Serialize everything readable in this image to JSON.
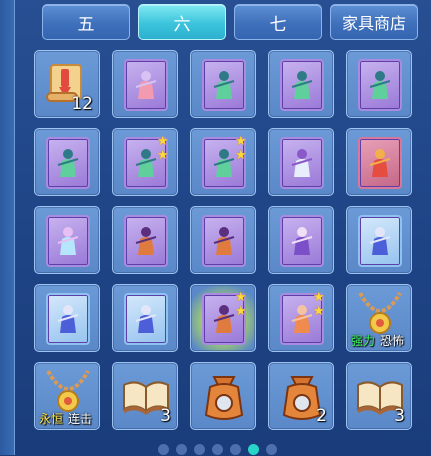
{
  "tabs": [
    {
      "label": "五",
      "active": false
    },
    {
      "label": "六",
      "active": true
    },
    {
      "label": "七",
      "active": false
    },
    {
      "label": "家具商店",
      "active": false
    }
  ],
  "items": [
    {
      "name": "scroll-item",
      "icon": "scroll-icon",
      "count": "12"
    },
    {
      "name": "pet-card",
      "icon": "pink-pet-card-icon",
      "count": ""
    },
    {
      "name": "hero-card",
      "icon": "green-warrior-card-icon",
      "count": ""
    },
    {
      "name": "hero-card",
      "icon": "green-warrior-card-icon",
      "count": ""
    },
    {
      "name": "hero-card",
      "icon": "green-warrior-card-icon",
      "count": ""
    },
    {
      "name": "hero-card",
      "icon": "green-warrior-card-icon",
      "count": ""
    },
    {
      "name": "hero-card",
      "icon": "green-warrior-card-icon",
      "stars": 2
    },
    {
      "name": "hero-card",
      "icon": "green-warrior-card-icon",
      "stars": 2
    },
    {
      "name": "mount-card",
      "icon": "white-serpent-card-icon",
      "count": ""
    },
    {
      "name": "hero-card",
      "icon": "red-warrior-card-icon",
      "count": ""
    },
    {
      "name": "fairy-card",
      "icon": "fairy-card-icon",
      "count": ""
    },
    {
      "name": "mount-card",
      "icon": "tiger-rider-card-icon",
      "count": ""
    },
    {
      "name": "mount-card",
      "icon": "tiger-rider-card-icon",
      "count": ""
    },
    {
      "name": "hero-card",
      "icon": "purple-lady-card-icon",
      "count": ""
    },
    {
      "name": "knight-card",
      "icon": "blue-knight-card-icon",
      "count": ""
    },
    {
      "name": "knight-card",
      "icon": "blue-knight-card-icon",
      "count": ""
    },
    {
      "name": "knight-card",
      "icon": "blue-knight-card-icon",
      "count": ""
    },
    {
      "name": "mount-card",
      "icon": "tiger-rider-card-icon",
      "stars": 2
    },
    {
      "name": "pet-card",
      "icon": "fox-pet-card-icon",
      "stars": 2
    },
    {
      "name": "necklace-item",
      "icon": "necklace-icon",
      "tags": [
        "强力",
        "恐怖"
      ]
    },
    {
      "name": "necklace-item",
      "icon": "necklace-icon",
      "tags": [
        "永恒",
        "连击"
      ]
    },
    {
      "name": "book-item",
      "icon": "open-book-icon",
      "count": "3"
    },
    {
      "name": "pouch-item",
      "icon": "orange-pouch-icon",
      "count": ""
    },
    {
      "name": "pouch-item",
      "icon": "orange-pouch-icon",
      "count": "2"
    },
    {
      "name": "book-item",
      "icon": "open-book-icon",
      "count": "3"
    }
  ],
  "pagination": {
    "total": 7,
    "current": 6
  },
  "colors": {
    "accent": "#2fc2d9",
    "star": "#ffd93a",
    "tag_green": "#3df05c",
    "tag_yellow": "#ffe34a",
    "tag_white": "#ffffff"
  }
}
